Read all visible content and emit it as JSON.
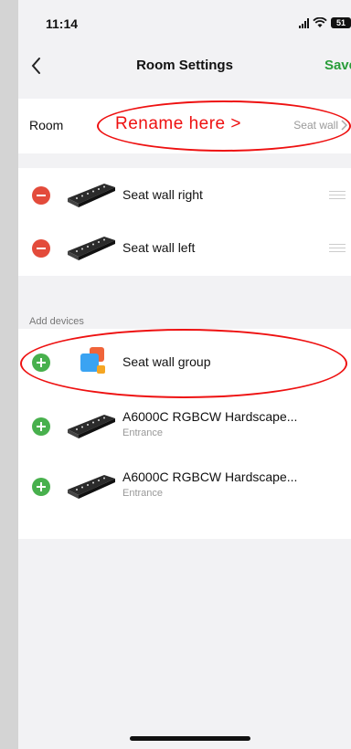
{
  "caption": "",
  "status": {
    "time": "11:14",
    "battery": "51"
  },
  "nav": {
    "title": "Room Settings",
    "save_label": "Save"
  },
  "room": {
    "label": "Room",
    "value": "Seat wall",
    "annotation": "Rename here >"
  },
  "devices": [
    {
      "name": "Seat wall right"
    },
    {
      "name": "Seat wall left"
    }
  ],
  "add_section": {
    "label": "Add devices"
  },
  "add_devices": [
    {
      "name": "Seat wall group",
      "subtitle": ""
    },
    {
      "name": "A6000C RGBCW Hardscape...",
      "subtitle": "Entrance"
    },
    {
      "name": "A6000C RGBCW Hardscape...",
      "subtitle": "Entrance"
    }
  ],
  "colors": {
    "accent": "#2a9d3a",
    "remove": "#e34b3b",
    "add": "#48b04d",
    "annotation": "#ee1111"
  }
}
